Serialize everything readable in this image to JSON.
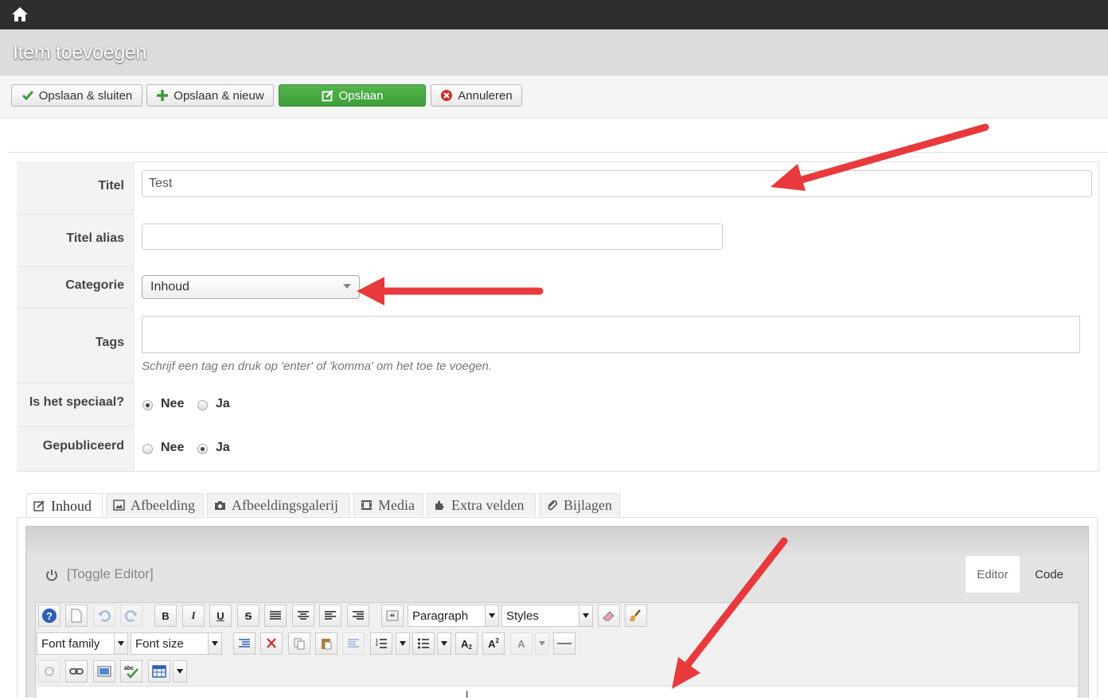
{
  "header": {
    "title": "Item toevoegen"
  },
  "toolbar": {
    "save_close": "Opslaan & sluiten",
    "save_new": "Opslaan & nieuw",
    "save": "Opslaan",
    "cancel": "Annuleren"
  },
  "form": {
    "title_label": "Titel",
    "title_value": "Test",
    "alias_label": "Titel alias",
    "alias_value": "",
    "category_label": "Categorie",
    "category_value": "Inhoud",
    "tags_label": "Tags",
    "tags_help": "Schrijf een tag en druk op 'enter' of 'komma' om het toe te voegen.",
    "special_label": "Is het speciaal?",
    "special_options": [
      "Nee",
      "Ja"
    ],
    "special_selected": "Nee",
    "published_label": "Gepubliceerd",
    "published_options": [
      "Nee",
      "Ja"
    ],
    "published_selected": "Ja"
  },
  "tabs": [
    "Inhoud",
    "Afbeelding",
    "Afbeeldingsgalerij",
    "Media",
    "Extra velden",
    "Bijlagen"
  ],
  "editor": {
    "toggle_label": "[Toggle Editor]",
    "tab_editor": "Editor",
    "tab_code": "Code",
    "format_select": "Paragraph",
    "styles_select": "Styles",
    "font_family_select": "Font family",
    "font_size_select": "Font size"
  },
  "colors": {
    "green_button": "#47a843",
    "annotation_arrow": "#e8393c",
    "topbar": "#2e2e2e"
  }
}
